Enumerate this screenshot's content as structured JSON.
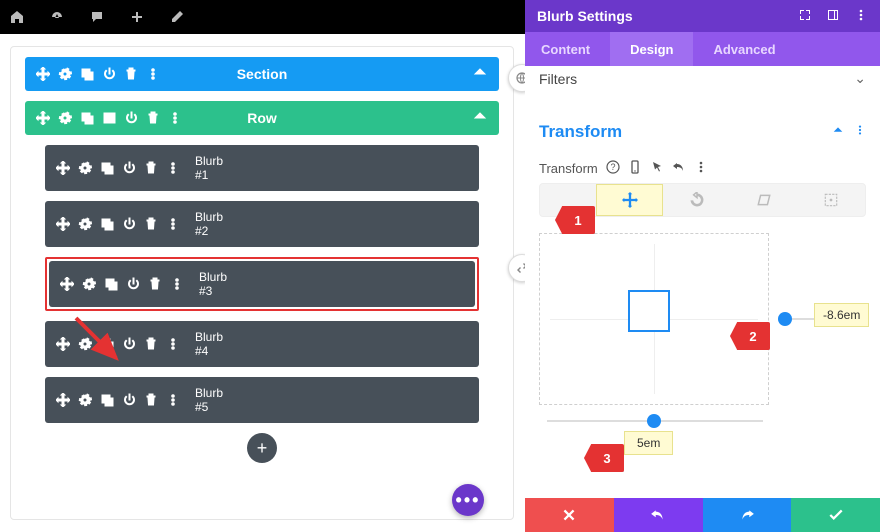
{
  "topbar": {
    "icons": [
      "home",
      "dashboard",
      "comment",
      "plus",
      "pencil"
    ],
    "badge": "✱"
  },
  "builder": {
    "section_label": "Section",
    "row_label": "Row",
    "modules": [
      {
        "label": "Blurb",
        "num": "#1",
        "selected": false
      },
      {
        "label": "Blurb",
        "num": "#2",
        "selected": false
      },
      {
        "label": "Blurb",
        "num": "#3",
        "selected": true
      },
      {
        "label": "Blurb",
        "num": "#4",
        "selected": false
      },
      {
        "label": "Blurb",
        "num": "#5",
        "selected": false
      }
    ],
    "add_label": "+"
  },
  "panel": {
    "title": "Blurb Settings",
    "tabs": {
      "content": "Content",
      "design": "Design",
      "advanced": "Advanced"
    },
    "active_tab": "design",
    "filters_label": "Filters",
    "transform": {
      "heading": "Transform",
      "label": "Transform",
      "x_value": "-8.6em",
      "y_value": "5em"
    }
  },
  "annotations": {
    "a1": "1",
    "a2": "2",
    "a3": "3"
  }
}
